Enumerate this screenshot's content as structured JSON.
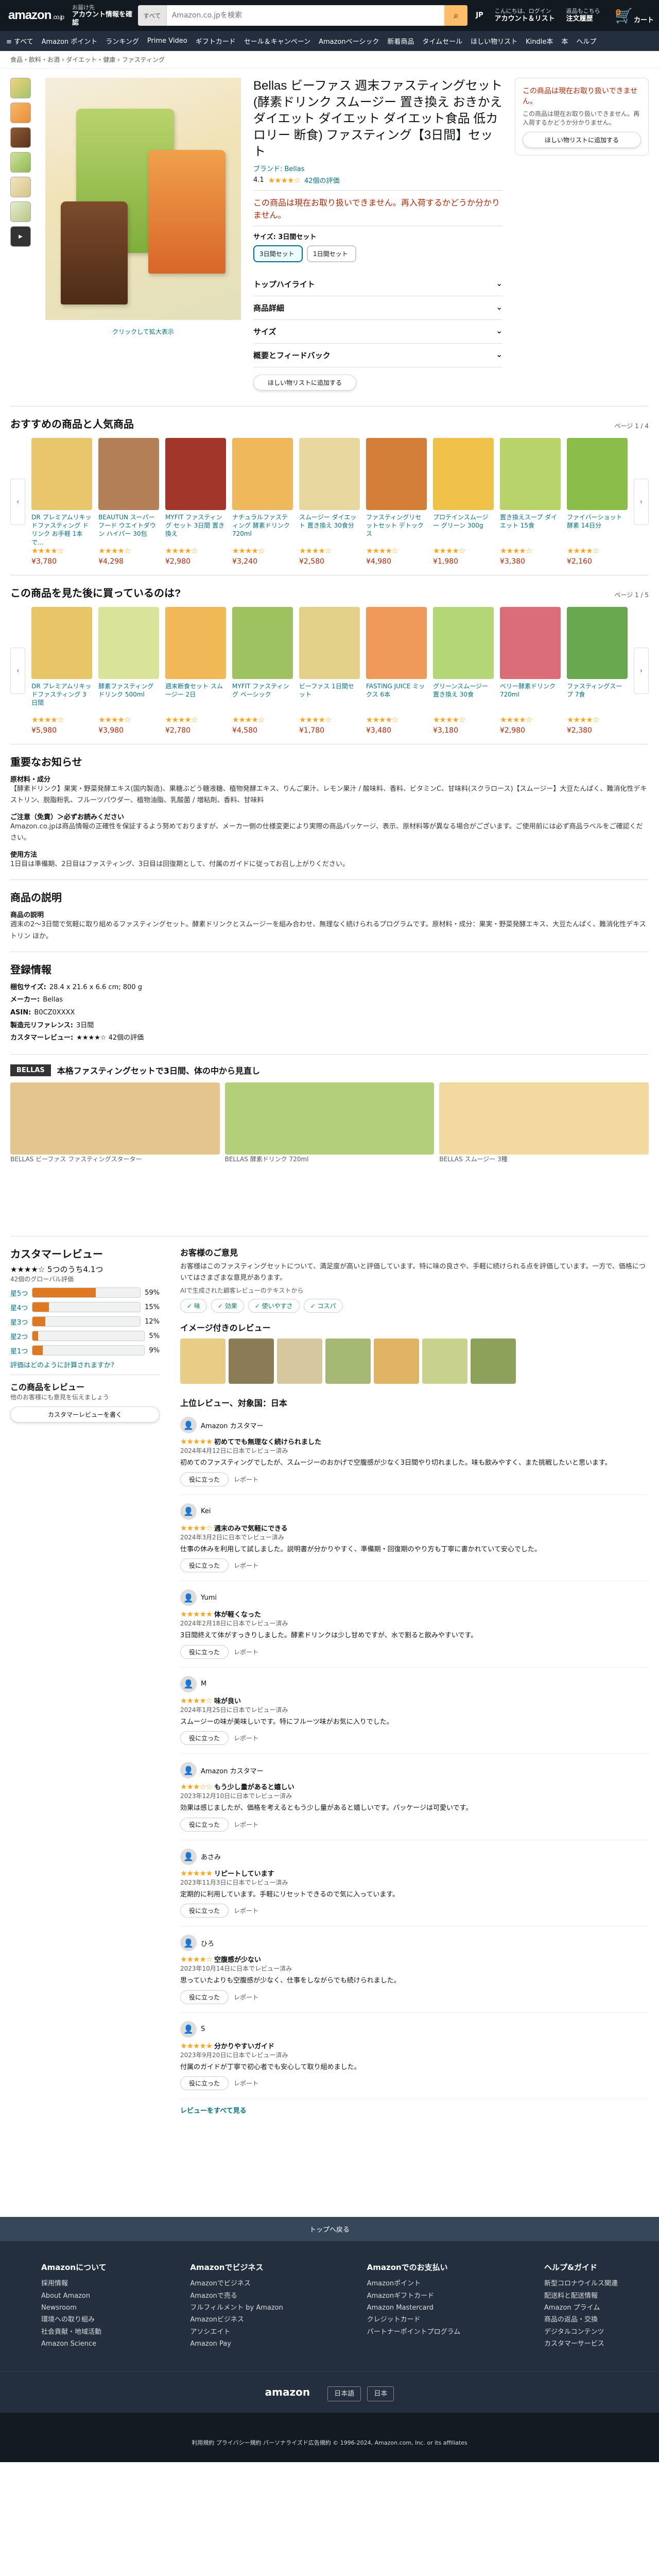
{
  "header": {
    "logo": "amazon",
    "logo_suffix": ".co.jp",
    "deliver_line1": "お届け先",
    "deliver_line2": "アカウント情報を確認",
    "search_cat": "すべて",
    "search_placeholder": "Amazon.co.jpを検索",
    "lang": "JP",
    "acct_line1": "こんにちは、ログイン",
    "acct_line2": "アカウント＆リスト",
    "orders_line1": "返品もこちら",
    "orders_line2": "注文履歴",
    "cart_count": "0",
    "cart_label": "カート"
  },
  "nav": [
    "≡ すべて",
    "Amazon ポイント",
    "ランキング",
    "Prime Video",
    "ギフトカード",
    "セール＆キャンペーン",
    "Amazonベーシック",
    "新着商品",
    "タイムセール",
    "ほしい物リスト",
    "Kindle本",
    "本",
    "ヘルプ"
  ],
  "breadcrumb": "食品・飲料・お酒 › ダイエット・健康 › ファスティング",
  "product": {
    "title": "Bellas ビーファス 週末ファスティングセット (酵素ドリンク スムージー 置き換え おきかえ ダイエット ダイエット ダイエット食品 低カロリー 断食) ファスティング【3日間】セット",
    "brand": "ブランド: Bellas",
    "rating": "4.1",
    "rating_count": "42個の評価",
    "price_note": "この商品は現在お取り扱いできません。",
    "availability": "この商品は現在お取り扱いできません。再入荷するかどうか分かりません。",
    "select_label": "サイズ: 3日間セット",
    "options": [
      {
        "name": "3日間セット",
        "sel": true
      },
      {
        "name": "1日間セット",
        "sel": false
      }
    ],
    "accordions": [
      "トップハイライト",
      "商品詳細",
      "サイズ",
      "概要とフィードバック"
    ],
    "zoom": "クリックして拡大表示"
  },
  "buybox": {
    "msg": "この商品は現在お取り扱いできません。",
    "sub": "この商品は現在お取り扱いできません。再入荷するかどうか分かりません。",
    "btn": "ほしい物リストに追加する"
  },
  "sponsored": {
    "title": "おすすめの商品と人気商品",
    "page": "ページ 1 / 4",
    "items": [
      {
        "t": "DR プレミアムリキッドファスティング ドリンク お手軽 1本で...",
        "p": "¥3,780",
        "s": "★★★★☆",
        "c": "#e9c56c"
      },
      {
        "t": "BEAUTUN スーパーフード ウエイトダウン ハイパー 30包",
        "p": "¥4,298",
        "s": "★★★★☆",
        "c": "#b27f57"
      },
      {
        "t": "MYFIT ファスティング セット 3日間 置き換え",
        "p": "¥2,980",
        "s": "★★★★☆",
        "c": "#a3362a"
      },
      {
        "t": "ナチュラルファスティング 酵素ドリンク 720ml",
        "p": "¥3,240",
        "s": "★★★★☆",
        "c": "#efb85a"
      },
      {
        "t": "スムージー ダイエット 置き換え 30食分",
        "p": "¥2,580",
        "s": "★★★★☆",
        "c": "#e8d8a0"
      },
      {
        "t": "ファスティングリセットセット デトックス",
        "p": "¥4,980",
        "s": "★★★★☆",
        "c": "#d37f3a"
      },
      {
        "t": "プロテインスムージー グリーン 300g",
        "p": "¥1,980",
        "s": "★★★★☆",
        "c": "#f1c24a"
      },
      {
        "t": "置き換えスープ ダイエット 15食",
        "p": "¥3,380",
        "s": "★★★★☆",
        "c": "#b9d36b"
      },
      {
        "t": "ファイバーショット 酵素 14日分",
        "p": "¥2,160",
        "s": "★★★★☆",
        "c": "#8bbd4a"
      }
    ]
  },
  "viewed": {
    "title": "この商品を見た後に買っているのは?",
    "page": "ページ 1 / 5",
    "items": [
      {
        "t": "DR プレミアムリキッドファスティング 3日間",
        "p": "¥5,980",
        "s": "★★★★☆",
        "c": "#e8c667"
      },
      {
        "t": "酵素ファスティング ドリンク 500ml",
        "p": "¥3,980",
        "s": "★★★★☆",
        "c": "#d9e39a"
      },
      {
        "t": "週末断食セット スムージー 2日",
        "p": "¥2,780",
        "s": "★★★★☆",
        "c": "#f0b856"
      },
      {
        "t": "MYFIT ファスティング ベーシック",
        "p": "¥4,580",
        "s": "★★★★☆",
        "c": "#9dc25f"
      },
      {
        "t": "ビーファス 1日間セット",
        "p": "¥1,780",
        "s": "★★★★☆",
        "c": "#e3d18a"
      },
      {
        "t": "FASTING JUICE ミックス 6本",
        "p": "¥3,480",
        "s": "★★★★☆",
        "c": "#ef9a5b"
      },
      {
        "t": "グリーンスムージー 置き換え 30食",
        "p": "¥3,180",
        "s": "★★★★☆",
        "c": "#b5d676"
      },
      {
        "t": "ベリー酵素ドリンク 720ml",
        "p": "¥2,980",
        "s": "★★★★☆",
        "c": "#db6d78"
      },
      {
        "t": "ファスティングスープ 7食",
        "p": "¥2,380",
        "s": "★★★★☆",
        "c": "#6aa84f"
      }
    ]
  },
  "important": {
    "title": "重要なお知らせ",
    "s1": "原材料・成分",
    "t1": "【酵素ドリンク】果実・野菜発酵エキス(国内製造)、果糖ぶどう糖液糖、植物発酵エキス、りんご果汁、レモン果汁 / 酸味料、香料、ビタミンC、甘味料(スクラロース)【スムージー】大豆たんぱく、難消化性デキストリン、脱脂粉乳、フルーツパウダー、植物油脂、乳酸菌 / 増粘剤、香料、甘味料",
    "s2": "ご注意（免責）＞必ずお読みください",
    "t2": "Amazon.co.jpは商品情報の正確性を保証するよう努めておりますが、メーカー側の仕様変更により実際の商品パッケージ、表示、原材料等が異なる場合がございます。ご使用前には必ず商品ラベルをご確認ください。",
    "s3": "使用方法",
    "t3": "1日目は準備期、2日目はファスティング、3日目は回復期として、付属のガイドに従ってお召し上がりください。"
  },
  "description": {
    "title": "商品の説明",
    "sub": "商品の説明",
    "text": "週末の2〜3日間で気軽に取り組めるファスティングセット。酵素ドリンクとスムージーを組み合わせ、無理なく続けられるプログラムです。原材料・成分：果実・野菜発酵エキス、大豆たんぱく、難消化性デキストリン ほか。"
  },
  "details": {
    "title": "登録情報",
    "rows": [
      {
        "k": "梱包サイズ",
        "v": "28.4 x 21.6 x 6.6 cm; 800 g"
      },
      {
        "k": "メーカー",
        "v": "Bellas"
      },
      {
        "k": "ASIN",
        "v": "B0CZ0XXXX"
      },
      {
        "k": "製造元リファレンス",
        "v": "3日間"
      },
      {
        "k": "カスタマーレビュー",
        "v": "★★★★☆ 42個の評価"
      }
    ]
  },
  "brandstory": {
    "label": "BELLAS",
    "title": "本格ファスティングセットで3日間、体の中から見直し",
    "items": [
      {
        "t": "BELLAS ビーファス ファスティングスターター",
        "c": "#e4c58e"
      },
      {
        "t": "BELLAS 酵素ドリンク 720ml",
        "c": "#b4cf7a"
      },
      {
        "t": "BELLAS スムージー 3種",
        "c": "#f1d9a0"
      }
    ]
  },
  "reviews_summary": {
    "title": "カスタマーレビュー",
    "avg": "★★★★☆ 5つのうち4.1つ",
    "global": "42個のグローバル評価",
    "bars": [
      {
        "l": "星5つ",
        "v": 59
      },
      {
        "l": "星4つ",
        "v": 15
      },
      {
        "l": "星3つ",
        "v": 12
      },
      {
        "l": "星2つ",
        "v": 5
      },
      {
        "l": "星1つ",
        "v": 9
      }
    ],
    "how": "評価はどのように計算されますか?",
    "write_title": "この商品をレビュー",
    "write_sub": "他のお客様にも意見を伝えましょう",
    "write_btn": "カスタマーレビューを書く"
  },
  "customer_says": {
    "title": "お客様のご意見",
    "text": "お客様はこのファスティングセットについて、満足度が高いと評価しています。特に味の良さや、手軽に続けられる点を評価しています。一方で、価格についてはさまざまな意見があります。",
    "ai": "AIで生成された顧客レビューのテキストから",
    "tags": [
      "味",
      "効果",
      "使いやすさ",
      "コスパ"
    ]
  },
  "imgreviews": {
    "title": "イメージ付きのレビュー"
  },
  "top_reviews": {
    "title": "上位レビュー、対象国：日本",
    "items": [
      {
        "name": "Amazon カスタマー",
        "stars": "★★★★★",
        "title": "初めてでも無理なく続けられました",
        "date": "2024年4月12日に日本でレビュー済み",
        "body": "初めてのファスティングでしたが、スムージーのおかげで空腹感が少なく3日間やり切れました。味も飲みやすく、また挑戦したいと思います。"
      },
      {
        "name": "Kei",
        "stars": "★★★★☆",
        "title": "週末のみで気軽にできる",
        "date": "2024年3月2日に日本でレビュー済み",
        "body": "仕事の休みを利用して試しました。説明書が分かりやすく、準備期・回復期のやり方も丁寧に書かれていて安心でした。"
      },
      {
        "name": "Yumi",
        "stars": "★★★★★",
        "title": "体が軽くなった",
        "date": "2024年2月18日に日本でレビュー済み",
        "body": "3日間終えて体がすっきりしました。酵素ドリンクは少し甘めですが、水で割ると飲みやすいです。"
      },
      {
        "name": "M",
        "stars": "★★★★☆",
        "title": "味が良い",
        "date": "2024年1月25日に日本でレビュー済み",
        "body": "スムージーの味が美味しいです。特にフルーツ味がお気に入りでした。"
      },
      {
        "name": "Amazon カスタマー",
        "stars": "★★★☆☆",
        "title": "もう少し量があると嬉しい",
        "date": "2023年12月10日に日本でレビュー済み",
        "body": "効果は感じましたが、価格を考えるともう少し量があると嬉しいです。パッケージは可愛いです。"
      },
      {
        "name": "あさみ",
        "stars": "★★★★★",
        "title": "リピートしています",
        "date": "2023年11月3日に日本でレビュー済み",
        "body": "定期的に利用しています。手軽にリセットできるので気に入っています。"
      },
      {
        "name": "ひろ",
        "stars": "★★★★☆",
        "title": "空腹感が少ない",
        "date": "2023年10月14日に日本でレビュー済み",
        "body": "思っていたよりも空腹感が少なく、仕事をしながらでも続けられました。"
      },
      {
        "name": "S",
        "stars": "★★★★★",
        "title": "分かりやすいガイド",
        "date": "2023年9月20日に日本でレビュー済み",
        "body": "付属のガイドが丁寧で初心者でも安心して取り組めました。"
      }
    ],
    "helpful": "役に立った",
    "report": "レポート",
    "more": "レビューをすべて見る"
  },
  "footer": {
    "top": "トップへ戻る",
    "cols": [
      {
        "h": "Amazonについて",
        "i": [
          "採用情報",
          "About Amazon",
          "Newsroom",
          "環境への取り組み",
          "社会貢献・地域活動",
          "Amazon Science"
        ]
      },
      {
        "h": "Amazonでビジネス",
        "i": [
          "Amazonでビジネス",
          "Amazonで売る",
          "フルフィルメント by Amazon",
          "Amazonビジネス",
          "アソシエイト",
          "Amazon Pay"
        ]
      },
      {
        "h": "Amazonでのお支払い",
        "i": [
          "Amazonポイント",
          "Amazonギフトカード",
          "Amazon Mastercard",
          "クレジットカード",
          "パートナーポイントプログラム"
        ]
      },
      {
        "h": "ヘルプ&ガイド",
        "i": [
          "新型コロナウイルス関連",
          "配送料と配送情報",
          "Amazon プライム",
          "商品の返品・交換",
          "デジタルコンテンツ",
          "カスタマーサービス"
        ]
      }
    ],
    "lang": "日本語",
    "country": "日本",
    "copyright": "利用規約 プライバシー規約 パーソナライズド広告規約 © 1996-2024, Amazon.com, Inc. or its affiliates"
  }
}
